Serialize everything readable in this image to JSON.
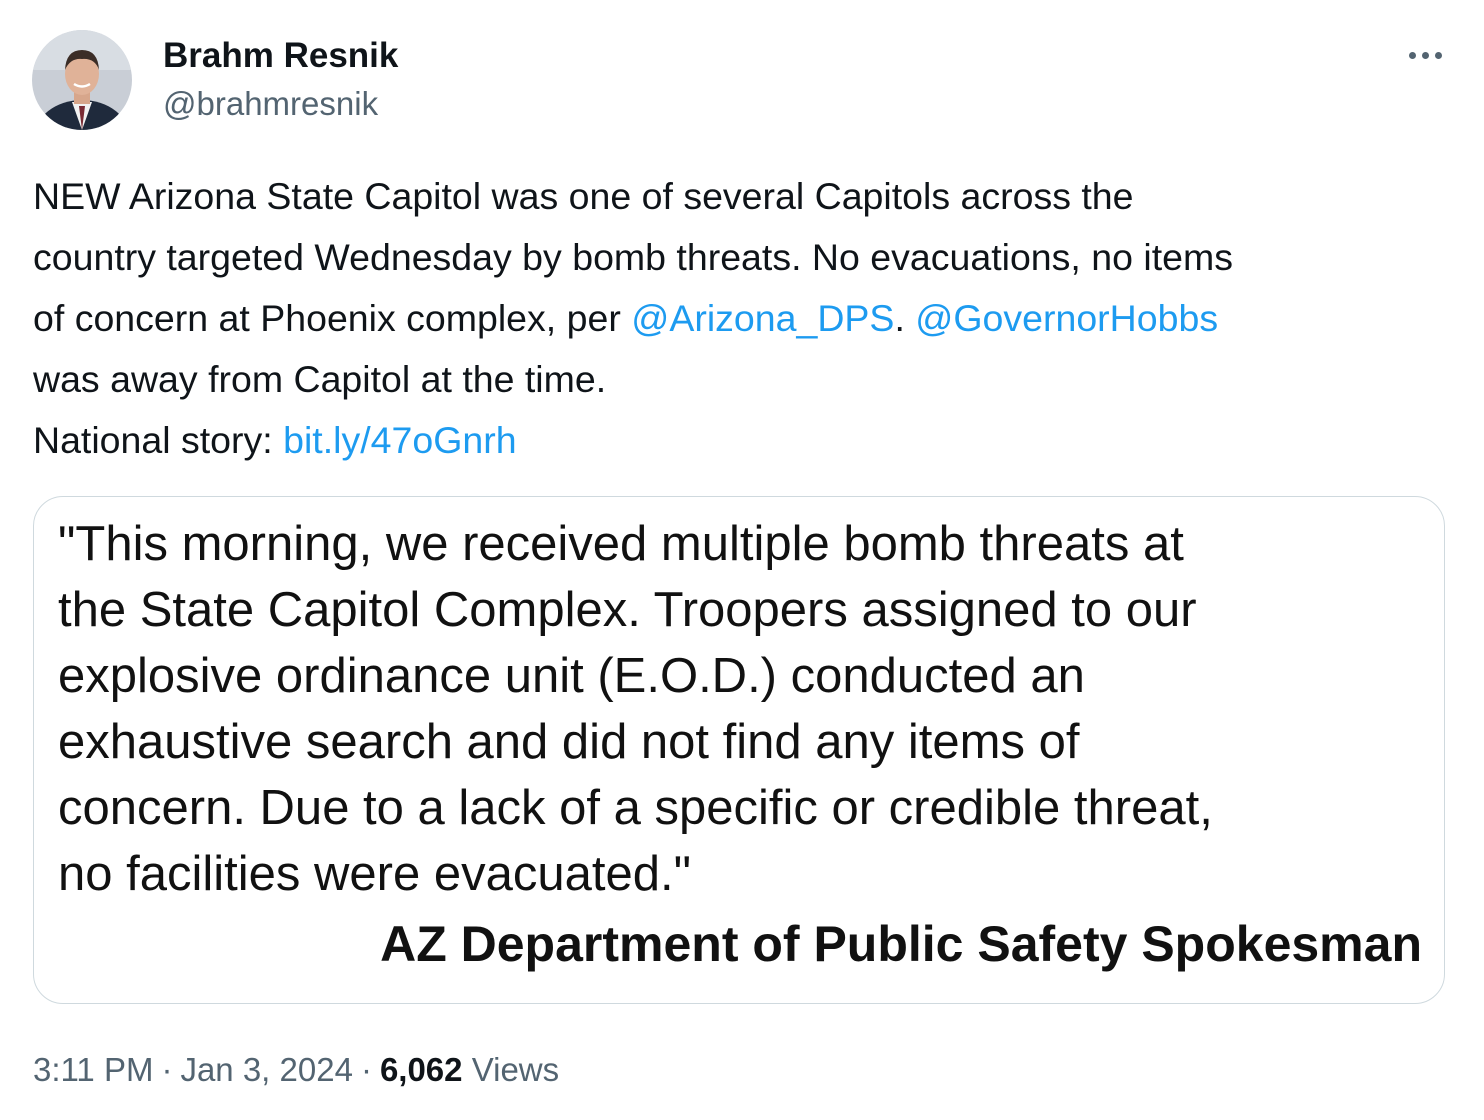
{
  "author": {
    "display_name": "Brahm Resnik",
    "handle": "@brahmresnik"
  },
  "tweet": {
    "lines": [
      [
        {
          "text": "NEW Arizona State Capitol was one of several Capitols across the"
        }
      ],
      [
        {
          "text": "country targeted Wednesday by bomb threats. No evacuations, no items"
        }
      ],
      [
        {
          "text": "of concern at Phoenix complex, per "
        },
        {
          "text": "@Arizona_DPS",
          "link": true
        },
        {
          "text": ". "
        },
        {
          "text": "@GovernorHobbs",
          "link": true
        }
      ],
      [
        {
          "text": "was away from Capitol at the time."
        }
      ],
      [
        {
          "text": "National story: "
        },
        {
          "text": "bit.ly/47oGnrh",
          "link": true
        }
      ]
    ]
  },
  "media": {
    "quote_lines": [
      "\"This morning, we received multiple bomb threats at",
      "the State Capitol Complex. Troopers assigned to our",
      "explosive ordinance unit (E.O.D.) conducted an",
      "exhaustive search and did not find any items of",
      "concern. Due to a lack of a specific or credible threat,",
      "no facilities were evacuated.\""
    ],
    "attribution": "AZ Department of Public Safety Spokesman"
  },
  "meta": {
    "time": "3:11 PM",
    "separator": "·",
    "date": "Jan 3, 2024",
    "views_count": "6,062",
    "views_label": "Views"
  },
  "icons": {
    "more": "more-options-icon",
    "avatar": "profile-photo"
  },
  "colors": {
    "link": "#1d9bf0",
    "text": "#0f1419",
    "secondary": "#536471",
    "border": "#cfd9de"
  }
}
